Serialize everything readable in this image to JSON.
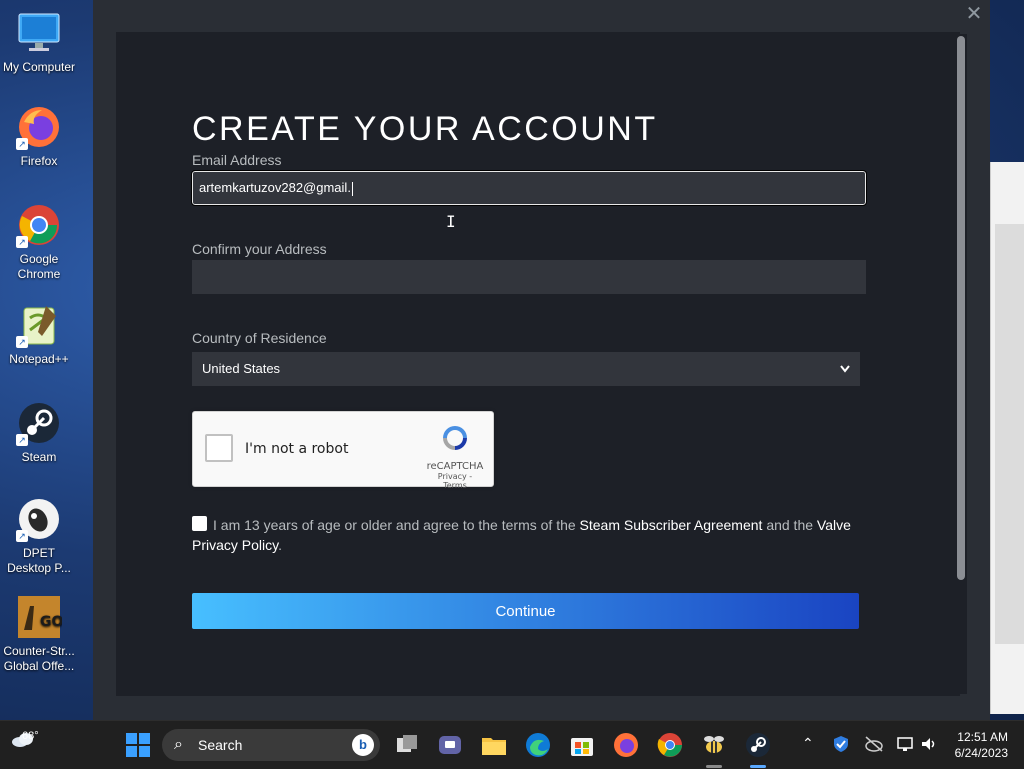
{
  "desktop": {
    "icons": [
      {
        "label": "My Computer"
      },
      {
        "label": "Firefox"
      },
      {
        "label": "Google Chrome"
      },
      {
        "label": "Notepad++"
      },
      {
        "label": "Steam"
      },
      {
        "label": "DPET Desktop P..."
      },
      {
        "label": "Counter-Str... Global Offe..."
      }
    ]
  },
  "dialog": {
    "title": "CREATE YOUR ACCOUNT",
    "email_label": "Email Address",
    "email_value": "artemkartuzov282@gmail.",
    "confirm_label": "Confirm your Address",
    "confirm_value": "",
    "country_label": "Country of Residence",
    "country_value": "United States",
    "recaptcha": {
      "checkbox_text": "I'm not a robot",
      "brand": "reCAPTCHA",
      "links": "Privacy - Terms"
    },
    "agreement": {
      "text_1": "I am 13 years of age or older and agree to the terms of the",
      "link_1": "Steam Subscriber Agreement",
      "text_2": "and the",
      "link_2": "Valve Privacy Policy",
      "text_3": "."
    },
    "continue_label": "Continue",
    "close_glyph": "✕"
  },
  "taskbar": {
    "weather": "68°",
    "search_label": "Search",
    "clock_time": "12:51 AM",
    "clock_date": "6/24/2023"
  },
  "colors": {
    "dialog_bg": "#2a2e35",
    "panel_bg": "#1d2027",
    "input_bg": "#32353c",
    "button_start": "#47bfff",
    "button_end": "#1a44c2"
  }
}
